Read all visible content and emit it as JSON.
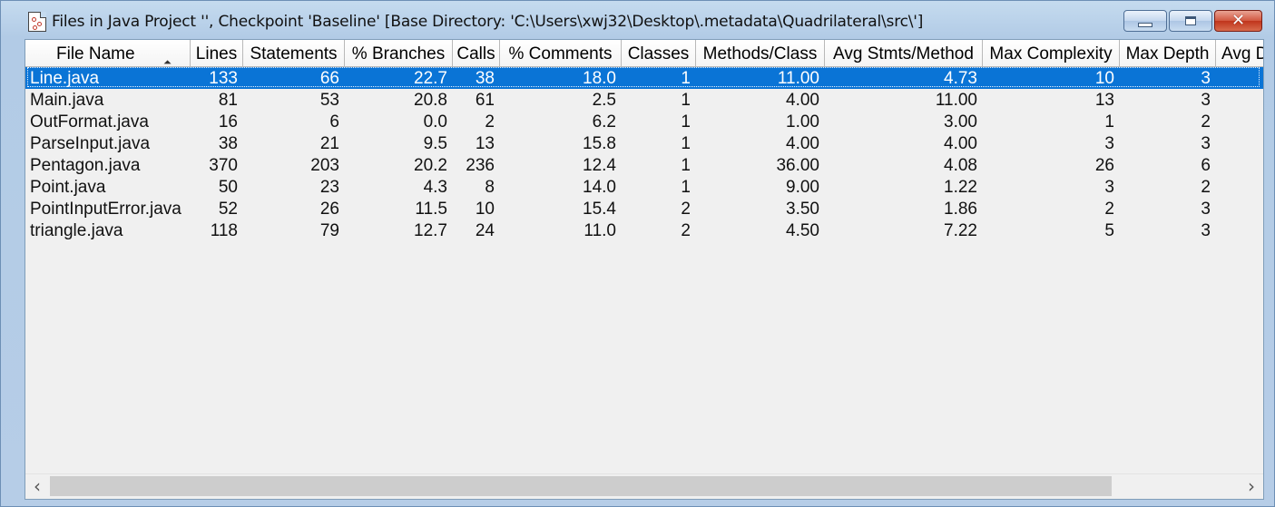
{
  "window": {
    "title": "Files in Java Project '', Checkpoint 'Baseline'  [Base Directory: 'C:\\Users\\xwj32\\Desktop\\.metadata\\Quadrilateral\\src\\']",
    "close_glyph": "✕"
  },
  "table": {
    "columns": [
      "File Name",
      "Lines",
      "Statements",
      "% Branches",
      "Calls",
      "% Comments",
      "Classes",
      "Methods/Class",
      "Avg Stmts/Method",
      "Max Complexity",
      "Max Depth",
      "Avg Depth"
    ],
    "sorted_column": "File Name",
    "sort_arrow": "⏶",
    "selected_row": 0,
    "rows": [
      [
        "Line.java",
        "133",
        "66",
        "22.7",
        "38",
        "18.0",
        "1",
        "11.00",
        "4.73",
        "10",
        "3",
        ""
      ],
      [
        "Main.java",
        "81",
        "53",
        "20.8",
        "61",
        "2.5",
        "1",
        "4.00",
        "11.00",
        "13",
        "3",
        ""
      ],
      [
        "OutFormat.java",
        "16",
        "6",
        "0.0",
        "2",
        "6.2",
        "1",
        "1.00",
        "3.00",
        "1",
        "2",
        ""
      ],
      [
        "ParseInput.java",
        "38",
        "21",
        "9.5",
        "13",
        "15.8",
        "1",
        "4.00",
        "4.00",
        "3",
        "3",
        ""
      ],
      [
        "Pentagon.java",
        "370",
        "203",
        "20.2",
        "236",
        "12.4",
        "1",
        "36.00",
        "4.08",
        "26",
        "6",
        ""
      ],
      [
        "Point.java",
        "50",
        "23",
        "4.3",
        "8",
        "14.0",
        "1",
        "9.00",
        "1.22",
        "3",
        "2",
        ""
      ],
      [
        "PointInputError.java",
        "52",
        "26",
        "11.5",
        "10",
        "15.4",
        "2",
        "3.50",
        "1.86",
        "2",
        "3",
        ""
      ],
      [
        "triangle.java",
        "118",
        "79",
        "12.7",
        "24",
        "11.0",
        "2",
        "4.50",
        "7.22",
        "5",
        "3",
        ""
      ]
    ]
  },
  "scrollbar": {
    "left_arrow": "‹",
    "right_arrow": "›"
  }
}
